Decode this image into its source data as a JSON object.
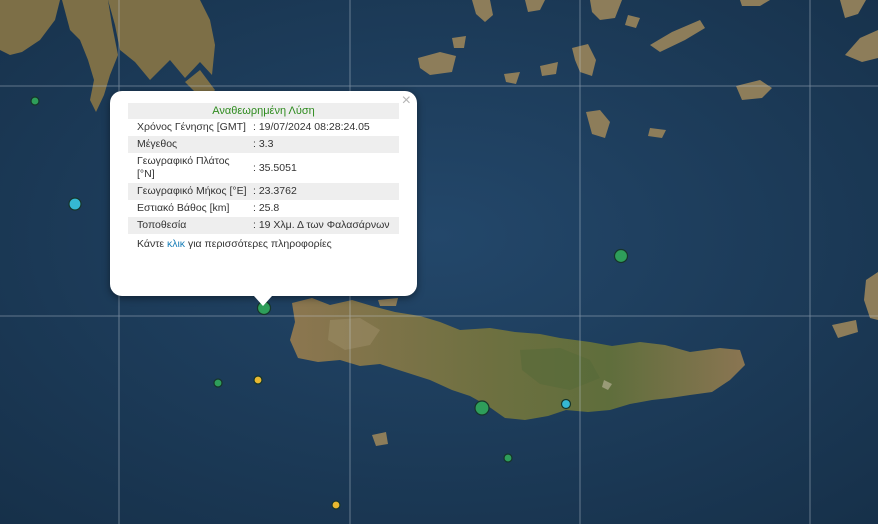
{
  "popup": {
    "title": "Αναθεωρημένη Λύση",
    "close_symbol": "×",
    "rows": [
      {
        "label": "Χρόνος Γένησης [GMT]",
        "value": ": 19/07/2024 08:28:24.05"
      },
      {
        "label": "Μέγεθος",
        "value": ": 3.3"
      },
      {
        "label": "Γεωγραφικό Πλάτος [°N]",
        "value": ": 35.5051"
      },
      {
        "label": "Γεωγραφικό Μήκος [°E]",
        "value": ": 23.3762"
      },
      {
        "label": "Εστιακό Βάθος [km]",
        "value": ": 25.8"
      },
      {
        "label": "Τοποθεσία",
        "value": ": 19 Χλμ. Δ των Φαλασάρνων"
      }
    ],
    "more_prefix": "Κάντε",
    "more_link": "κλικ",
    "more_suffix": "για περισσότερες πληροφορίες"
  },
  "colors": {
    "sea": "#1f3f5c",
    "land": "#8a7a52",
    "grid": "#c8d2dc",
    "marker_green": "#2e9e5a",
    "marker_cyan": "#35b8d2",
    "marker_yellow": "#e8b830"
  },
  "markers": [
    {
      "name": "event-selected",
      "color": "green"
    },
    {
      "name": "event",
      "color": "green"
    },
    {
      "name": "event",
      "color": "cyan"
    },
    {
      "name": "event",
      "color": "green"
    },
    {
      "name": "event",
      "color": "green"
    },
    {
      "name": "event",
      "color": "green"
    },
    {
      "name": "event",
      "color": "yellow"
    },
    {
      "name": "event",
      "color": "green"
    },
    {
      "name": "event",
      "color": "cyan"
    },
    {
      "name": "event",
      "color": "green"
    },
    {
      "name": "event",
      "color": "yellow"
    }
  ]
}
